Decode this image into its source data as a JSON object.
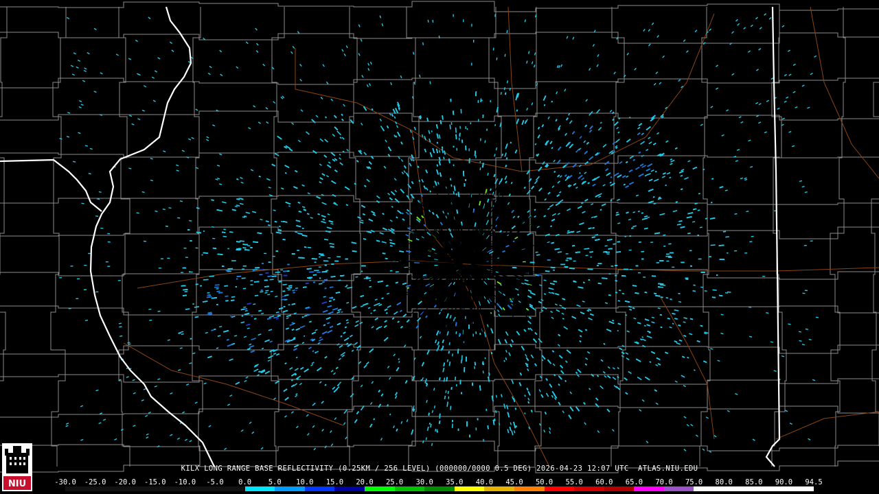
{
  "product": {
    "caption": "KILX LONG RANGE BASE REFLECTIVITY (0.25KM / 256 LEVEL) (000000/0000 0.5 DEG) 2026-04-23 12:07 UTC  ATLAS.NIU.EDU",
    "radar_site": "KILX",
    "timestamp": "2026-04-23 12:07 UTC",
    "source": "ATLAS.NIU.EDU"
  },
  "logo": {
    "text": "NIU",
    "colors": {
      "red": "#c8102e",
      "white": "#ffffff",
      "black": "#000000"
    }
  },
  "color_scale": {
    "labels": [
      "-30.0",
      "-25.0",
      "-20.0",
      "-15.0",
      "-10.0",
      "-5.0",
      "0.0",
      "5.0",
      "10.0",
      "15.0",
      "20.0",
      "25.0",
      "30.0",
      "35.0",
      "40.0",
      "45.0",
      "50.0",
      "55.0",
      "60.0",
      "65.0",
      "70.0",
      "75.0",
      "80.0",
      "85.0",
      "90.0",
      "94.5"
    ],
    "colors": [
      "#000000",
      "#000000",
      "#000000",
      "#000000",
      "#000000",
      "#000000",
      "#00e4ff",
      "#009cff",
      "#0036ff",
      "#0000a0",
      "#00ff00",
      "#00c000",
      "#008c00",
      "#ffff00",
      "#e6b400",
      "#ff8000",
      "#ff0000",
      "#d20000",
      "#b00000",
      "#ff00ff",
      "#9955c8",
      "#ffffff",
      "#ffffff",
      "#ffffff",
      "#ffffff"
    ]
  },
  "map_colors": {
    "background": "#000000",
    "county_lines": "#8c8c8c",
    "state_lines": "#ffffff",
    "highways": "#8b4513"
  },
  "echoes": {
    "light_cyan": "#22c8e6",
    "medium_blue": "#1e78dc",
    "deep_blue": "#1e3cc8",
    "green": "#6ee628"
  }
}
